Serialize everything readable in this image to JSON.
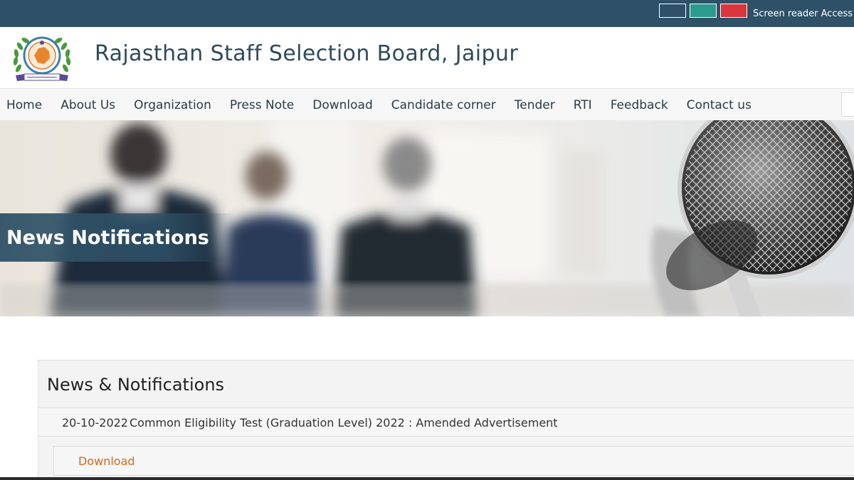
{
  "topbar": {
    "theme_swatches": [
      {
        "name": "default-blue",
        "color": "#2f5167"
      },
      {
        "name": "teal",
        "color": "#2b9a8f"
      },
      {
        "name": "red",
        "color": "#d9363e"
      }
    ],
    "screen_reader_label": "Screen reader Access"
  },
  "header": {
    "title": "Rajasthan Staff Selection Board, Jaipur",
    "emblem_icon": "rssb-emblem"
  },
  "nav": {
    "items": [
      {
        "label": "Home"
      },
      {
        "label": "About Us"
      },
      {
        "label": "Organization"
      },
      {
        "label": "Press Note"
      },
      {
        "label": "Download"
      },
      {
        "label": "Candidate corner"
      },
      {
        "label": "Tender"
      },
      {
        "label": "RTI"
      },
      {
        "label": "Feedback"
      },
      {
        "label": "Contact us"
      }
    ]
  },
  "banner": {
    "title": "News Notifications",
    "image_icon": "microphone-meeting-banner"
  },
  "content": {
    "heading": "News & Notifications",
    "notices": [
      {
        "date": "20-10-2022",
        "text": "Common Eligibility Test (Graduation Level) 2022 : Amended Advertisement",
        "download_label": "Download"
      }
    ]
  },
  "colors": {
    "primary": "#2f5167",
    "link": "#d2691e",
    "nav_bg": "#f7f7f7"
  }
}
